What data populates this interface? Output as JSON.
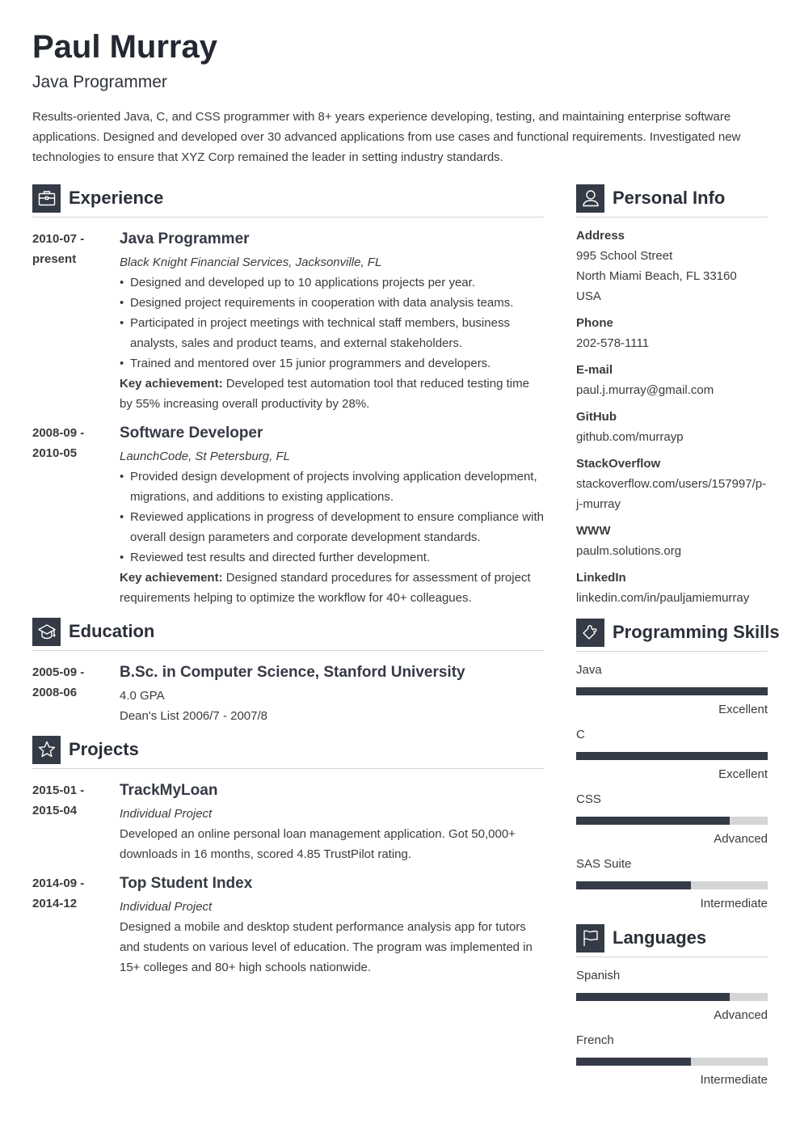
{
  "header": {
    "name": "Paul Murray",
    "title": "Java Programmer",
    "summary": "Results-oriented Java, C, and CSS programmer with 8+ years experience developing, testing, and maintaining enterprise software applications. Designed and developed over 30 advanced applications from use cases and functional requirements. Investigated new technologies to ensure that XYZ Corp remained the leader in setting industry standards."
  },
  "colors": {
    "accent": "#343a46",
    "bar_track": "#d4d5d5",
    "divider": "#d4d4d4"
  },
  "experience": {
    "title": "Experience",
    "icon": "briefcase-icon",
    "entries": [
      {
        "date_start": "2010-07 -",
        "date_end": "present",
        "role": "Java Programmer",
        "company": "Black Knight Financial Services, Jacksonville, FL",
        "bullets": [
          "Designed and developed up to 10 applications projects per year.",
          "Designed project requirements in cooperation with data analysis teams.",
          "Participated in project meetings with technical staff members, business analysts, sales and product teams, and external stakeholders.",
          "Trained and mentored over 15 junior programmers and developers."
        ],
        "key_label": "Key achievement:",
        "key_text": " Developed test automation tool that reduced testing time by 55% increasing overall productivity by 28%."
      },
      {
        "date_start": "2008-09 -",
        "date_end": "2010-05",
        "role": "Software Developer",
        "company": "LaunchCode, St Petersburg, FL",
        "bullets": [
          "Provided design development of projects involving application development, migrations, and additions to existing applications.",
          "Reviewed applications in progress of development to ensure compliance with overall design parameters and corporate development standards.",
          "Reviewed test results and directed further development."
        ],
        "key_label": "Key achievement:",
        "key_text": " Designed standard procedures for assessment of project requirements helping to optimize the workflow for 40+ colleagues."
      }
    ]
  },
  "education": {
    "title": "Education",
    "icon": "graduation-cap-icon",
    "entries": [
      {
        "date_start": "2005-09 -",
        "date_end": "2008-06",
        "degree": "B.Sc. in Computer Science, Stanford University",
        "lines": [
          "4.0 GPA",
          "Dean's List 2006/7 - 2007/8"
        ]
      }
    ]
  },
  "projects": {
    "title": "Projects",
    "icon": "star-icon",
    "entries": [
      {
        "date_start": "2015-01 -",
        "date_end": "2015-04",
        "name": "TrackMyLoan",
        "type": "Individual Project",
        "description": "Developed an online personal loan management application. Got 50,000+ downloads in 16 months, scored 4.85 TrustPilot rating."
      },
      {
        "date_start": "2014-09 -",
        "date_end": "2014-12",
        "name": "Top Student Index",
        "type": "Individual Project",
        "description": "Designed a mobile and desktop student performance analysis app for tutors and students on various level of education. The program was implemented in 15+ colleges and 80+ high schools nationwide."
      }
    ]
  },
  "personal_info": {
    "title": "Personal Info",
    "icon": "user-icon",
    "items": [
      {
        "label": "Address",
        "values": [
          "995 School Street",
          "North Miami Beach, FL 33160",
          "USA"
        ]
      },
      {
        "label": "Phone",
        "values": [
          "202-578-1111"
        ]
      },
      {
        "label": "E-mail",
        "values": [
          "paul.j.murray@gmail.com"
        ]
      },
      {
        "label": "GitHub",
        "values": [
          "github.com/murrayp"
        ]
      },
      {
        "label": "StackOverflow",
        "values": [
          "stackoverflow.com/users/157997/p-j-murray"
        ]
      },
      {
        "label": "WWW",
        "values": [
          "paulm.solutions.org"
        ]
      },
      {
        "label": "LinkedIn",
        "values": [
          "linkedin.com/in/pauljamiemurray"
        ]
      }
    ]
  },
  "skills": {
    "title": "Programming Skills",
    "icon": "puzzle-icon",
    "items": [
      {
        "name": "Java",
        "level": "Excellent",
        "fraction": 1.0
      },
      {
        "name": "C",
        "level": "Excellent",
        "fraction": 1.0
      },
      {
        "name": "CSS",
        "level": "Advanced",
        "fraction": 0.8
      },
      {
        "name": "SAS Suite",
        "level": "Intermediate",
        "fraction": 0.6
      }
    ]
  },
  "languages": {
    "title": "Languages",
    "icon": "flag-icon",
    "items": [
      {
        "name": "Spanish",
        "level": "Advanced",
        "fraction": 0.8
      },
      {
        "name": "French",
        "level": "Intermediate",
        "fraction": 0.6
      }
    ]
  }
}
